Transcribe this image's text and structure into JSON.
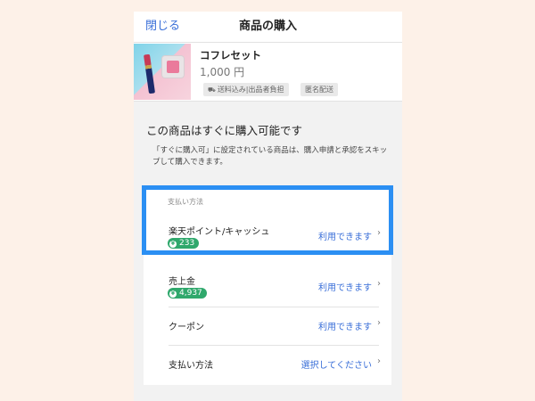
{
  "header": {
    "close_label": "閉じる",
    "title": "商品の購入"
  },
  "product": {
    "name": "コフレセット",
    "price": "1,000 円",
    "tags": {
      "shipping": "送料込み|出品者負担",
      "anonymous": "匿名配送"
    }
  },
  "info": {
    "title": "この商品はすぐに購入可能です",
    "description": "「すぐに購入可」に設定されている商品は、購入申請と承認をスキップして購入できます。"
  },
  "payment": {
    "section_label": "支払い方法",
    "rows": [
      {
        "label": "楽天ポイント/キャッシュ",
        "badge": "233",
        "action": "利用できます"
      },
      {
        "label": "売上金",
        "badge": "4,937",
        "action": "利用できます"
      },
      {
        "label": "クーポン",
        "action": "利用できます"
      },
      {
        "label": "支払い方法",
        "action": "選択してください"
      }
    ]
  },
  "colors": {
    "accent": "#3a6fd8",
    "badge": "#2fa86c",
    "highlight": "#2b8ff3",
    "background": "#fdf1e8"
  },
  "icons": {
    "chevron": "chevron-right-icon",
    "coin": "coin-icon",
    "truck": "truck-icon"
  }
}
